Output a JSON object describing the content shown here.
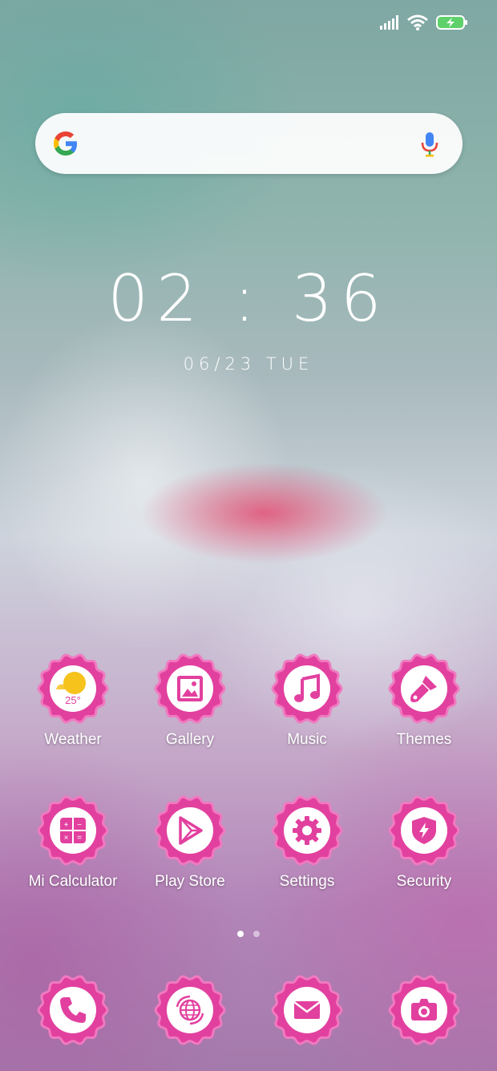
{
  "colors": {
    "accent": "#e2409f",
    "accent_light": "#f07ac0",
    "search_bg": "#ffffff"
  },
  "status_bar": {
    "icons": [
      "signal-icon",
      "wifi-icon",
      "battery-charging-icon"
    ]
  },
  "search": {
    "placeholder": "",
    "icons": [
      "google-g-icon",
      "microphone-icon"
    ]
  },
  "clock": {
    "time": "02 : 36",
    "date": "06/23 TUE"
  },
  "apps_row1": [
    {
      "label": "Weather",
      "icon": "weather-icon",
      "temp": "25°"
    },
    {
      "label": "Gallery",
      "icon": "gallery-icon"
    },
    {
      "label": "Music",
      "icon": "music-icon"
    },
    {
      "label": "Themes",
      "icon": "themes-brush-icon"
    }
  ],
  "apps_row2": [
    {
      "label": "Mi Calculator",
      "icon": "calculator-icon"
    },
    {
      "label": "Play Store",
      "icon": "play-store-icon"
    },
    {
      "label": "Settings",
      "icon": "settings-gear-icon"
    },
    {
      "label": "Security",
      "icon": "security-shield-icon"
    }
  ],
  "dock": [
    {
      "icon": "phone-icon"
    },
    {
      "icon": "browser-globe-icon"
    },
    {
      "icon": "messages-envelope-icon"
    },
    {
      "icon": "camera-icon"
    }
  ],
  "page_indicator": {
    "pages": 2,
    "current": 1
  }
}
